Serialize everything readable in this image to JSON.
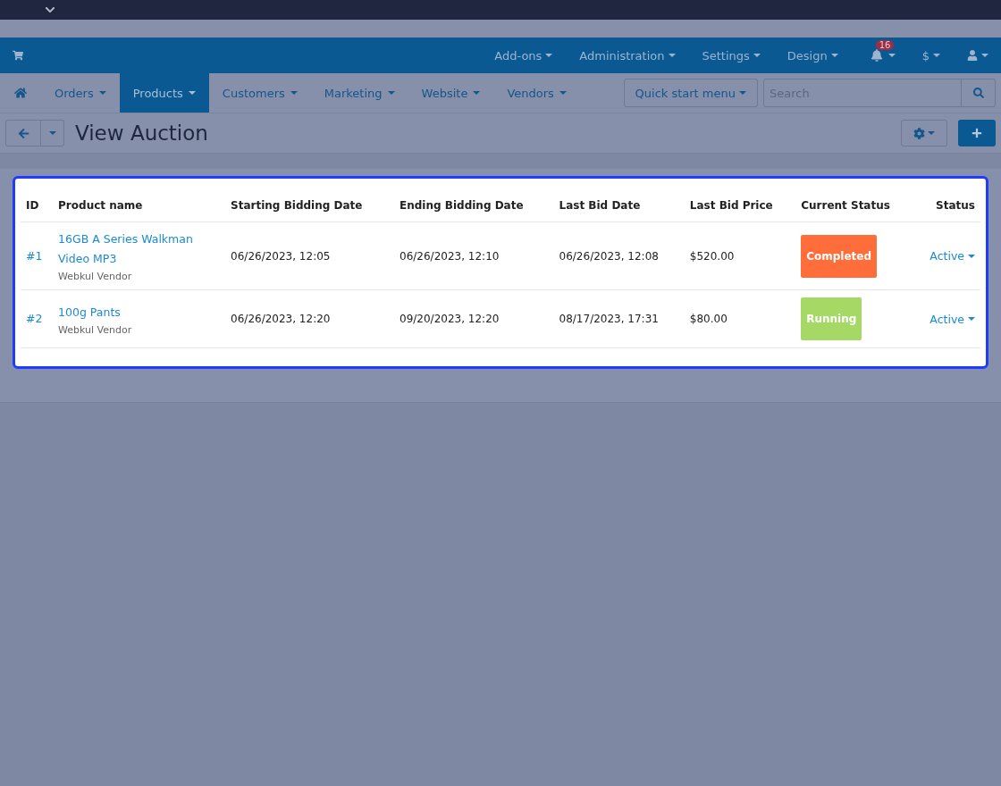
{
  "header": {
    "menus": [
      {
        "label": "Add-ons"
      },
      {
        "label": "Administration"
      },
      {
        "label": "Settings"
      },
      {
        "label": "Design"
      }
    ],
    "notifications": {
      "count": "16"
    },
    "currency": {
      "label": "$"
    }
  },
  "nav": {
    "items": [
      {
        "label": "Orders",
        "selected": false
      },
      {
        "label": "Products",
        "selected": true
      },
      {
        "label": "Customers",
        "selected": false
      },
      {
        "label": "Marketing",
        "selected": false
      },
      {
        "label": "Website",
        "selected": false
      },
      {
        "label": "Vendors",
        "selected": false
      }
    ],
    "quick_start": "Quick start menu",
    "search": {
      "placeholder": "Search"
    }
  },
  "toolbar": {
    "title": "View Auction"
  },
  "table": {
    "columns": [
      "ID",
      "Product name",
      "Starting Bidding Date",
      "Ending Bidding Date",
      "Last Bid Date",
      "Last Bid Price",
      "Current Status",
      "Status"
    ],
    "rows": [
      {
        "id": "#1",
        "product_lines": [
          "16GB A Series Walkman",
          "Video MP3"
        ],
        "vendor": "Webkul Vendor",
        "start": "06/26/2023, 12:05",
        "end": "06/26/2023, 12:10",
        "last_bid_date": "06/26/2023, 12:08",
        "price": "$520.00",
        "current_status": {
          "label": "Completed",
          "color": "#ff6d3a"
        },
        "status": "Active"
      },
      {
        "id": "#2",
        "product_lines": [
          "100g Pants"
        ],
        "vendor": "Webkul Vendor",
        "start": "06/26/2023, 12:20",
        "end": "09/20/2023, 12:20",
        "last_bid_date": "08/17/2023, 17:31",
        "price": "$80.00",
        "current_status": {
          "label": "Running",
          "color": "#a6d865"
        },
        "status": "Active"
      }
    ]
  }
}
